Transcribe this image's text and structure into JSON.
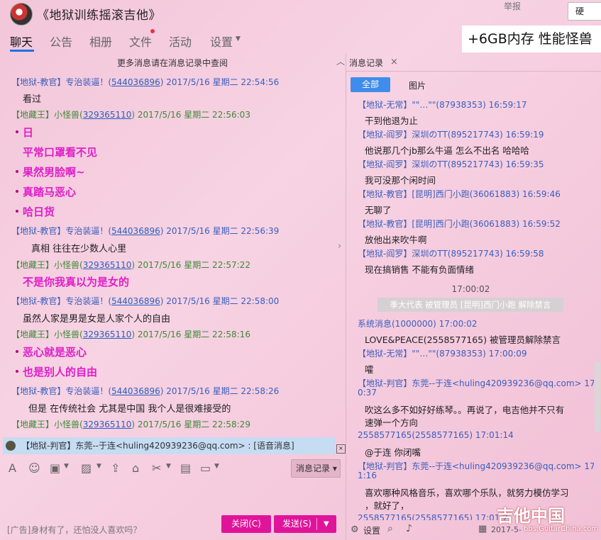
{
  "header": {
    "title": "《地狱训练摇滚吉他》",
    "report": "举报",
    "topright_button": "硬",
    "tabs": [
      "聊天",
      "公告",
      "相册",
      "文件",
      "活动",
      "设置"
    ],
    "ad_banner": "+6GB内存 性能怪兽"
  },
  "chat": {
    "more_hint": "更多消息请在消息记录中查阅",
    "messages": [
      {
        "role": "【地狱-教官】专治装逼！(",
        "qq": "544036896",
        "time": ") 2017/5/16 星期二 22:54:56"
      },
      {
        "role": "【地藏王】小怪兽(",
        "qq": "329365110",
        "time": ") 2017/5/16 星期二 22:56:03"
      },
      {
        "role": "【地狱-教官】专治装逼！(",
        "qq": "544036896",
        "time": ") 2017/5/16 星期二 22:56:39"
      },
      {
        "role": "【地藏王】小怪兽(",
        "qq": "329365110",
        "time": ") 2017/5/16 星期二 22:57:22"
      },
      {
        "role": "【地狱-教官】专治装逼！(",
        "qq": "544036896",
        "time": ") 2017/5/16 星期二 22:58:00"
      },
      {
        "role": "【地藏王】小怪兽(",
        "qq": "329365110",
        "time": ") 2017/5/16 星期二 22:58:16"
      },
      {
        "role": "【地狱-教官】专治装逼！(",
        "qq": "544036896",
        "time": ") 2017/5/16 星期二 22:58:26"
      },
      {
        "role": "【地藏王】小怪兽(",
        "qq": "329365110",
        "time": ") 2017/5/16 星期二 22:58:29"
      }
    ],
    "bodies": {
      "b1": "看过",
      "b2": "日",
      "b3": "平常口罩看不见",
      "b4": "果然男脸啊~",
      "b5": "真踏马恶心",
      "b6": "哈日货",
      "b7": "真相  往往在少数人心里",
      "b8": "不是你我真以为是女的",
      "b9": "虽然人家是男是女是人家个人的自由",
      "b10": "恶心就是恶心",
      "b11": "也是别人的自由",
      "b12": "但是    在传统社会  尤其是中国    我个人是很难接受的"
    },
    "voice_notice": "【地狱-判官】东莞--于连<huling420939236@qq.com> : [语音消息]"
  },
  "toolbar": {
    "history_button": "消息记录",
    "ad_text": "[广告]身材有了，还怕没人喜欢吗？",
    "close_button": "关闭(C)",
    "send_button": "发送(S)"
  },
  "history": {
    "tab": "消息记录",
    "filter_all": "全部",
    "filter_images": "图片",
    "time_divider": "17:00:02",
    "banner": "季大代表 被管理员 [昆明]西门小跑 解除禁言",
    "heads": [
      "【地狱-无常】\"\"…\"\"(87938353) 16:59:17",
      "【地狱-阎罗】深圳のTT(895217743) 16:59:19",
      "【地狱-阎罗】深圳のTT(895217743) 16:59:35",
      "【地狱-教官】[昆明]西门小跑(36061883) 16:59:46",
      "【地狱-教官】[昆明]西门小跑(36061883) 16:59:52",
      "【地狱-阎罗】深圳のTT(895217743) 16:59:58",
      "系统消息(1000000) 17:00:02",
      "【地狱-无常】\"\"…\"\"(87938353) 17:00:09",
      "【地狱-判官】东莞--于连<huling420939236@qq.com> 17:0",
      "0:37",
      "2558577165(2558577165) 17:01:14",
      "【地狱-判官】东莞--于连<huling420939236@qq.com> 17:0",
      "1:16",
      "2558577165(2558577165) 17:01:2"
    ],
    "bodies": [
      "干到他退为止",
      "他说那几个jb那么牛逼 怎么不出名 哈哈哈",
      "我可没那个闲时间",
      "无聊了",
      "放他出来吹牛啊",
      "现在搞销售 不能有负面情绪",
      "LOVE&PEACE(2558577165) 被管理员解除禁言",
      "嚯",
      "吹这么多不如好好练琴。。再说了，电吉他并不只有",
      "速弹一个方向",
      "@于连 你闭嘴",
      "喜欢哪种风格音乐，喜欢哪个乐队，就努力模仿学习",
      "，就好了，"
    ],
    "settings_label": "设置",
    "date_partial": "2017-5-",
    "site_logo": "吉他中国",
    "site_url": "bbs.GuitarChina.com"
  }
}
